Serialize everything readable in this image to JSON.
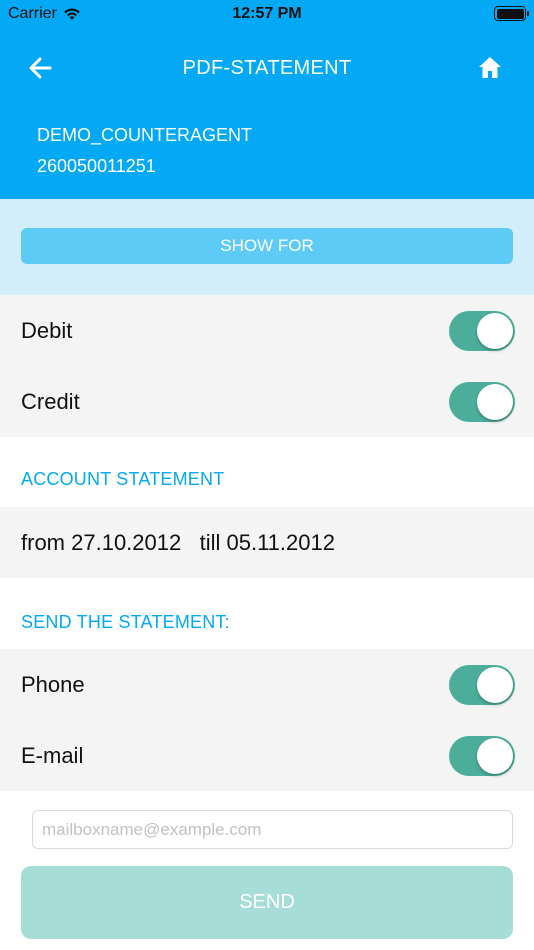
{
  "status_bar": {
    "carrier": "Carrier",
    "time": "12:57 PM"
  },
  "header": {
    "title": "PDF-STATEMENT",
    "agent_name": "DEMO_COUNTERAGENT",
    "agent_number": "260050011251"
  },
  "show_for": {
    "button_label": "SHOW FOR",
    "options": [
      {
        "label": "Debit",
        "enabled": true
      },
      {
        "label": "Credit",
        "enabled": true
      }
    ]
  },
  "account_statement": {
    "header": "ACCOUNT STATEMENT",
    "from_label": "from",
    "from_date": "27.10.2012",
    "till_label": "till",
    "till_date": "05.11.2012"
  },
  "send_statement": {
    "header": "SEND THE STATEMENT:",
    "options": [
      {
        "label": "Phone",
        "enabled": true
      },
      {
        "label": "E-mail",
        "enabled": true
      }
    ],
    "email_value": "",
    "email_placeholder": "mailboxname@example.com",
    "send_label": "SEND"
  },
  "colors": {
    "primary": "#03a9f4",
    "band": "#d3eefb",
    "toggle_on": "#4cae9a",
    "send_disabled": "#a6ddd7"
  }
}
